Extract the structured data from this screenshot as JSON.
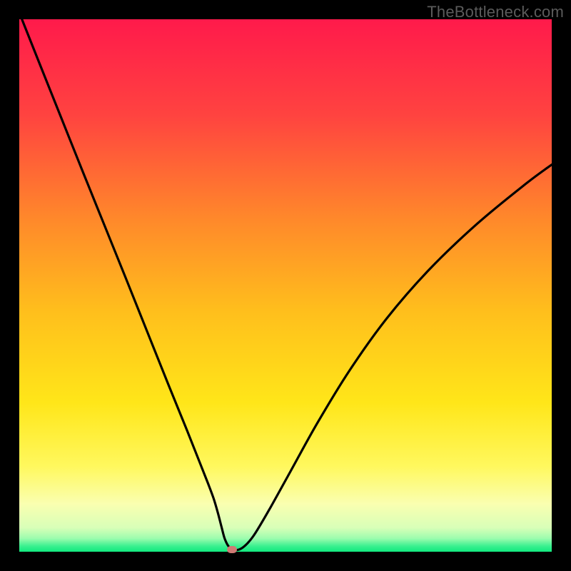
{
  "watermark": "TheBottleneck.com",
  "chart_data": {
    "type": "line",
    "title": "",
    "xlabel": "",
    "ylabel": "",
    "xlim": [
      0,
      100
    ],
    "ylim": [
      0,
      100
    ],
    "grid": false,
    "legend": false,
    "gradient_stops": [
      {
        "pos": 0.0,
        "color": "#ff1a4b"
      },
      {
        "pos": 0.18,
        "color": "#ff4340"
      },
      {
        "pos": 0.38,
        "color": "#ff8a2a"
      },
      {
        "pos": 0.55,
        "color": "#ffbf1c"
      },
      {
        "pos": 0.72,
        "color": "#ffe619"
      },
      {
        "pos": 0.84,
        "color": "#fff85e"
      },
      {
        "pos": 0.91,
        "color": "#faffb0"
      },
      {
        "pos": 0.955,
        "color": "#d8ffb8"
      },
      {
        "pos": 0.975,
        "color": "#9cfcae"
      },
      {
        "pos": 0.99,
        "color": "#37f08e"
      },
      {
        "pos": 1.0,
        "color": "#12e97f"
      }
    ],
    "series": [
      {
        "name": "bottleneck-curve",
        "x": [
          0.5,
          4,
          8,
          12,
          16,
          20,
          24,
          28,
          31.5,
          34,
          35.5,
          36.5,
          37.3,
          38.0,
          38.6,
          39.4,
          40.5,
          42,
          44,
          47,
          51,
          56,
          62,
          69,
          77,
          86,
          95,
          100
        ],
        "y": [
          100,
          91.2,
          81.2,
          71.2,
          61.3,
          51.4,
          41.4,
          31.4,
          22.8,
          16.5,
          12.7,
          10.0,
          7.3,
          4.6,
          2.4,
          0.9,
          0.3,
          0.8,
          3.0,
          8.0,
          15.2,
          24.2,
          34.0,
          43.8,
          53.0,
          61.6,
          69.0,
          72.7
        ]
      }
    ],
    "marker": {
      "x": 40.0,
      "y": 0.4,
      "color": "#cf7a74"
    }
  }
}
